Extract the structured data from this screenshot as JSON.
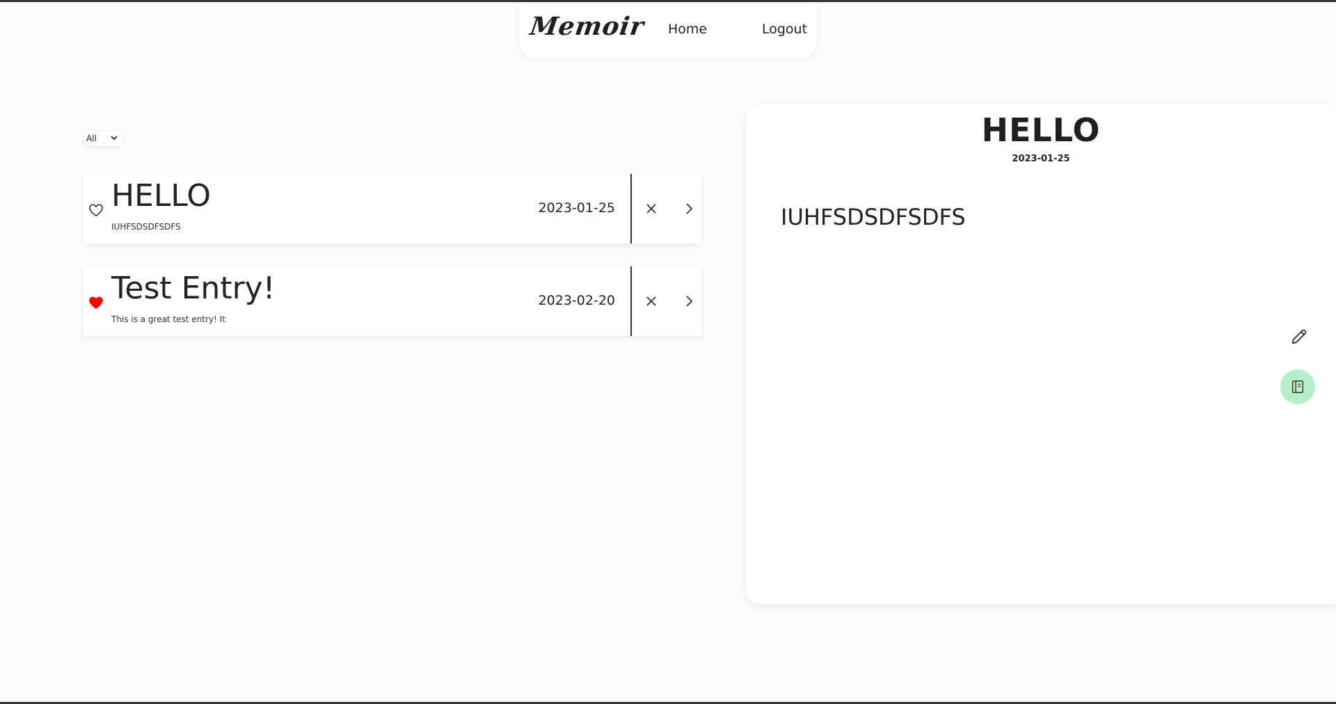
{
  "nav": {
    "brand": "Memoir",
    "home_label": "Home",
    "logout_label": "Logout"
  },
  "filter": {
    "selected": "All"
  },
  "entries": [
    {
      "title": "HELLO",
      "snippet": "IUHFSDSDFSDFS",
      "date": "2023-01-25",
      "favorite": false
    },
    {
      "title": "Test Entry!",
      "snippet": "This is a great test entry! It",
      "date": "2023-02-20",
      "favorite": true
    }
  ],
  "detail": {
    "title": "HELLO",
    "date": "2023-01-25",
    "body": "IUHFSDSDFSDFS"
  },
  "colors": {
    "favorite_heart": "#ff0000",
    "journal_button_bg": "#b6f0c8",
    "page_bg": "#fcfcfc"
  },
  "icons": {
    "close": "close-icon",
    "open": "chevron-right-icon",
    "favorite": "heart-icon",
    "edit": "pencil-icon",
    "journal": "journal-icon"
  }
}
